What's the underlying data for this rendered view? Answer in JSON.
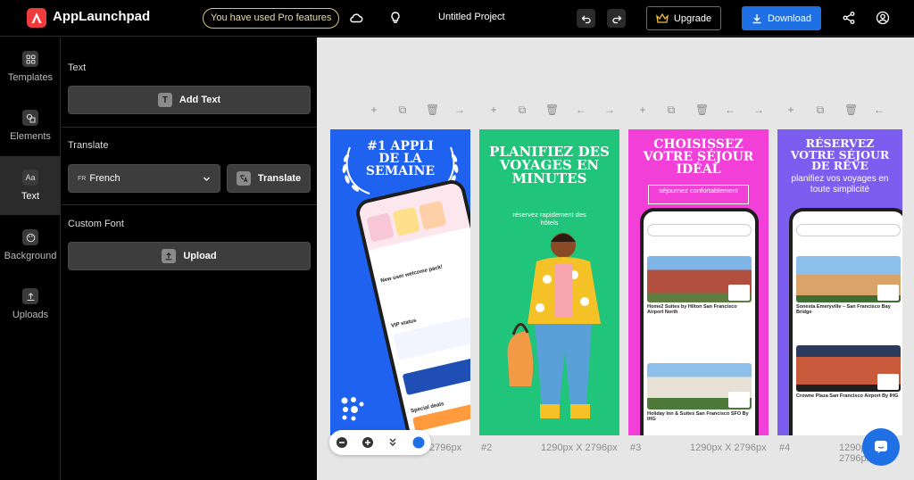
{
  "header": {
    "brand": "AppLaunchpad",
    "pro_notice": "You have used Pro features",
    "project_title": "Untitled Project",
    "upgrade_label": "Upgrade",
    "download_label": "Download"
  },
  "sidebar": {
    "items": [
      {
        "label": "Templates",
        "icon": "grid-icon"
      },
      {
        "label": "Elements",
        "icon": "shapes-icon"
      },
      {
        "label": "Text",
        "icon": "text-icon",
        "active": true
      },
      {
        "label": "Background",
        "icon": "palette-icon"
      },
      {
        "label": "Uploads",
        "icon": "upload-icon"
      }
    ]
  },
  "panel": {
    "text_section": "Text",
    "add_text_label": "Add Text",
    "translate_section": "Translate",
    "language": {
      "code": "FR",
      "name": "French"
    },
    "translate_label": "Translate",
    "custom_font_section": "Custom Font",
    "upload_label": "Upload"
  },
  "canvas": {
    "screens": [
      {
        "title": "#1 APPLI DE LA SEMAINE",
        "bg": "#1f62f0"
      },
      {
        "title": "PLANIFIEZ DES VOYAGES EN MINUTES",
        "subtitle": "réservez rapidement des hôtels",
        "bg": "#20c47a"
      },
      {
        "title": "CHOISISSEZ VOTRE SÉJOUR IDÉAL",
        "subtitle": "séjournez confortablement",
        "bg": "#f23fd8"
      },
      {
        "title": "RÉSERVEZ VOTRE SÉJOUR DE RÊVE",
        "subtitle": "planifiez vos voyages en toute simplicité",
        "bg": "#7b5df0"
      }
    ],
    "size_label": "1290px X 2796px",
    "size_label_partial": "2796px",
    "numbers": [
      "#2",
      "#3",
      "#4"
    ],
    "phone_texts": {
      "hotel1": "Home2 Suites by Hilton San Francisco Airport North",
      "hotel2": "Holiday Inn & Suites San Francisco SFO By IHG",
      "hotel3": "Sonesta Emeryville – San Francisco Bay Bridge",
      "hotel4": "Crowne Plaza San Francisco Airport By IHG",
      "new_user": "New user welcome pack!",
      "vip": "VIP status",
      "special": "Special deals"
    }
  },
  "colors": {
    "accent": "#1f6fe5",
    "brand": "#ef3b3b",
    "pro_border": "#d8c27a"
  }
}
